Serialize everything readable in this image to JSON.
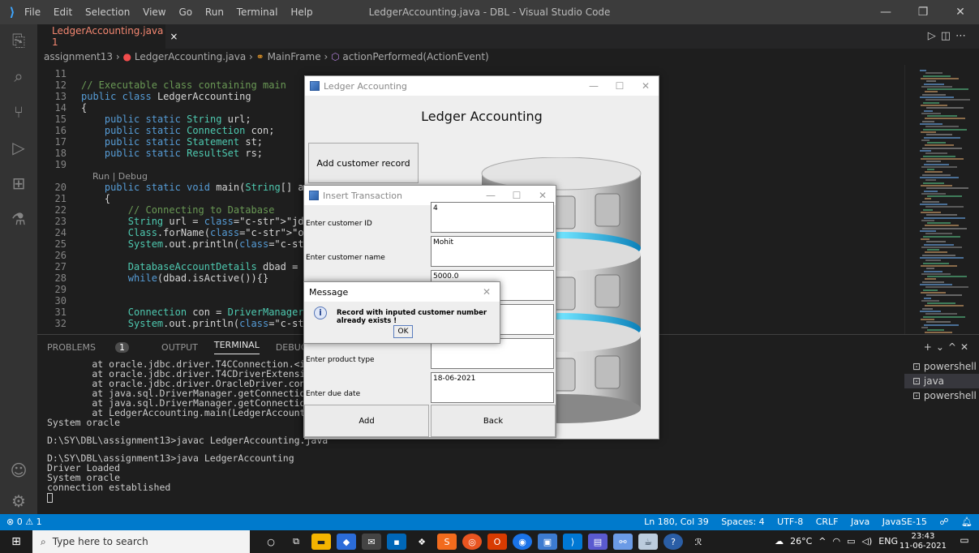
{
  "vscode": {
    "menu": [
      "File",
      "Edit",
      "Selection",
      "View",
      "Go",
      "Run",
      "Terminal",
      "Help"
    ],
    "window_title": "LedgerAccounting.java - DBL - Visual Studio Code",
    "tab": {
      "label": "LedgerAccounting.java 1",
      "close": "×"
    },
    "breadcrumb": {
      "folder": "assignment13",
      "file": "LedgerAccounting.java",
      "class": "MainFrame",
      "method": "actionPerformed(ActionEvent)"
    },
    "code_lines": [
      {
        "n": "11",
        "t": ""
      },
      {
        "n": "12",
        "t": "// Executable class containing main"
      },
      {
        "n": "13",
        "t": "public class LedgerAccounting"
      },
      {
        "n": "14",
        "t": "{"
      },
      {
        "n": "15",
        "t": "    public static String url;"
      },
      {
        "n": "16",
        "t": "    public static Connection con;"
      },
      {
        "n": "17",
        "t": "    public static Statement st;"
      },
      {
        "n": "18",
        "t": "    public static ResultSet rs;"
      },
      {
        "n": "19",
        "t": ""
      },
      {
        "n": "",
        "t": "    Run | Debug"
      },
      {
        "n": "20",
        "t": "    public static void main(String[] args) thr"
      },
      {
        "n": "21",
        "t": "    {"
      },
      {
        "n": "22",
        "t": "        // Connecting to Database"
      },
      {
        "n": "23",
        "t": "        String url = \"jdbc:oracle:thin:@localh"
      },
      {
        "n": "24",
        "t": "        Class.forName(\"oracle.jdbc.driver.Orac"
      },
      {
        "n": "25",
        "t": "        System.out.println(\"Driver Loaded\");"
      },
      {
        "n": "26",
        "t": ""
      },
      {
        "n": "27",
        "t": "        DatabaseAccountDetails dbad = new Data"
      },
      {
        "n": "28",
        "t": "        while(dbad.isActive()){}"
      },
      {
        "n": "29",
        "t": ""
      },
      {
        "n": "30",
        "t": ""
      },
      {
        "n": "31",
        "t": "        Connection con = DriverManager.getConn"
      },
      {
        "n": "32",
        "t": "        System.out.println(\"connection establi"
      }
    ],
    "panel_tabs": {
      "problems": "PROBLEMS",
      "problems_count": "1",
      "output": "OUTPUT",
      "terminal": "TERMINAL",
      "debug": "DEBUG CONSOLE"
    },
    "terminal_lines": [
      "        at oracle.jdbc.driver.T4CConnection.<init>(T4CCo",
      "        at oracle.jdbc.driver.T4CDriverExtension.getConn",
      "        at oracle.jdbc.driver.OracleDriver.connect(Oracl",
      "        at java.sql.DriverManager.getConnection(DriverMa",
      "        at java.sql.DriverManager.getConnection(DriverMa",
      "        at LedgerAccounting.main(LedgerAccounting.java:3",
      "System oracle",
      "",
      "D:\\SY\\DBL\\assignment13>javac LedgerAccounting.java",
      "",
      "D:\\SY\\DBL\\assignment13>java LedgerAccounting",
      "Driver Loaded",
      "System oracle",
      "connection established"
    ],
    "terminal_list": [
      "powershell",
      "java",
      "powershell"
    ],
    "status": {
      "left": "⊗ 0 ⚠ 1",
      "items": [
        "Ln 180, Col 39",
        "Spaces: 4",
        "UTF-8",
        "CRLF",
        "Java",
        "JavaSE-15"
      ]
    }
  },
  "taskbar": {
    "search_placeholder": "Type here to search",
    "weather": "26°C",
    "lang": "ENG",
    "time": "23:43",
    "date": "11-06-2021"
  },
  "ledger_window": {
    "title": "Ledger Accounting",
    "heading": "Ledger Accounting",
    "add_customer_button": "Add customer record"
  },
  "insert_window": {
    "title": "Insert Transaction",
    "fields": [
      {
        "label": "Enter customer ID",
        "value": "4"
      },
      {
        "label": "Enter customer name",
        "value": "Mohit"
      },
      {
        "label": "",
        "value": "5000.0"
      },
      {
        "label": "",
        "value": ""
      },
      {
        "label": "Enter product type",
        "value": ""
      },
      {
        "label": "Enter due date",
        "value": "18-06-2021"
      }
    ],
    "add_button": "Add",
    "back_button": "Back"
  },
  "message_dialog": {
    "title": "Message",
    "text": "Record with inputed customer number already exists !",
    "ok": "OK"
  }
}
